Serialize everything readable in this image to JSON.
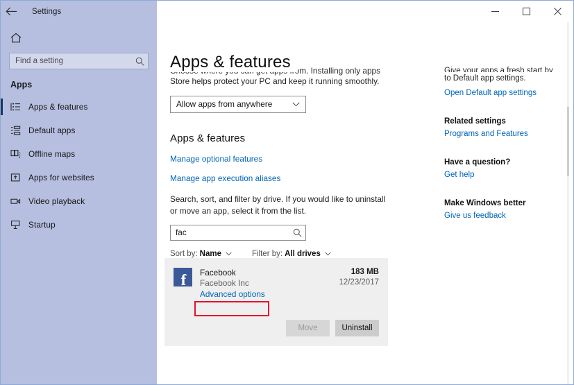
{
  "window": {
    "title": "Settings",
    "back_icon": "back-arrow-icon",
    "minimize_label": "Minimize",
    "maximize_label": "Maximize",
    "close_label": "Close"
  },
  "nav": {
    "home_icon": "home-icon",
    "search": {
      "placeholder": "Find a setting",
      "value": "",
      "icon": "search-icon"
    },
    "group_title": "Apps",
    "items": [
      {
        "label": "Apps & features",
        "icon": "list-icon",
        "selected": true
      },
      {
        "label": "Default apps",
        "icon": "default-apps-icon",
        "selected": false
      },
      {
        "label": "Offline maps",
        "icon": "map-icon",
        "selected": false
      },
      {
        "label": "Apps for websites",
        "icon": "website-apps-icon",
        "selected": false
      },
      {
        "label": "Video playback",
        "icon": "video-icon",
        "selected": false
      },
      {
        "label": "Startup",
        "icon": "startup-icon",
        "selected": false
      }
    ]
  },
  "page": {
    "title": "Apps & features",
    "clipped_intro": "Choose where you can get apps from. Installing only apps from the",
    "intro_line": "Store helps protect your PC and keep it running smoothly.",
    "source_select": {
      "value": "Allow apps from anywhere",
      "caret_icon": "chevron-down-icon"
    },
    "section_heading": "Apps & features",
    "links": [
      "Manage optional features",
      "Manage app execution aliases"
    ],
    "description": "Search, sort, and filter by drive. If you would like to uninstall or move an app, select it from the list.",
    "app_search": {
      "value": "fac",
      "placeholder": "",
      "icon": "search-icon"
    },
    "filters": [
      {
        "label": "Sort by:",
        "value": "Name",
        "caret_icon": "chevron-down-icon"
      },
      {
        "label": "Filter by:",
        "value": "All drives",
        "caret_icon": "chevron-down-icon"
      }
    ]
  },
  "app_card": {
    "icon": "facebook-icon",
    "icon_glyph": "f",
    "icon_color": "#3b5998",
    "name": "Facebook",
    "publisher": "Facebook Inc",
    "advanced_link": "Advanced options",
    "size": "183 MB",
    "date": "12/23/2017",
    "buttons": [
      {
        "label": "Move",
        "disabled": true
      },
      {
        "label": "Uninstall",
        "disabled": false
      }
    ]
  },
  "annotation": {
    "color": "#e8102a",
    "target": "Advanced options"
  },
  "right_column": {
    "clipped_top": "Give your apps a fresh start by going",
    "top_text": "to Default app settings.",
    "top_link": "Open Default app settings",
    "blocks": [
      {
        "heading": "Related settings",
        "link": "Programs and Features"
      },
      {
        "heading": "Have a question?",
        "link": "Get help"
      },
      {
        "heading": "Make Windows better",
        "link": "Give us feedback"
      }
    ]
  }
}
